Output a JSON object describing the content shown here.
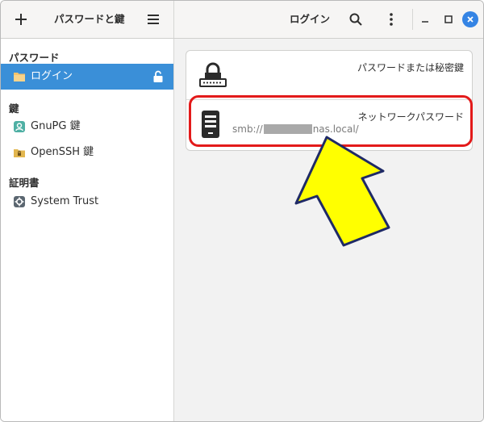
{
  "header": {
    "app_title": "パスワードと鍵",
    "view_title": "ログイン"
  },
  "sidebar": {
    "sections": [
      {
        "heading": "パスワード",
        "items": [
          {
            "label": "ログイン",
            "selected": true
          }
        ]
      },
      {
        "heading": "鍵",
        "items": [
          {
            "label": "GnuPG 鍵"
          },
          {
            "label": "OpenSSH 鍵"
          }
        ]
      },
      {
        "heading": "証明書",
        "items": [
          {
            "label": "System Trust"
          }
        ]
      }
    ]
  },
  "main": {
    "items": [
      {
        "description": "パスワードまたは秘密鍵",
        "subtitle": ""
      },
      {
        "description": "ネットワークパスワード",
        "subtitle_prefix": "smb://",
        "subtitle_suffix": "nas.local/"
      }
    ]
  },
  "colors": {
    "selection": "#3a8fd8",
    "highlight": "#e31a1a",
    "arrow_fill": "#ffff00",
    "arrow_stroke": "#1f2a66",
    "close_button": "#3584e4"
  }
}
